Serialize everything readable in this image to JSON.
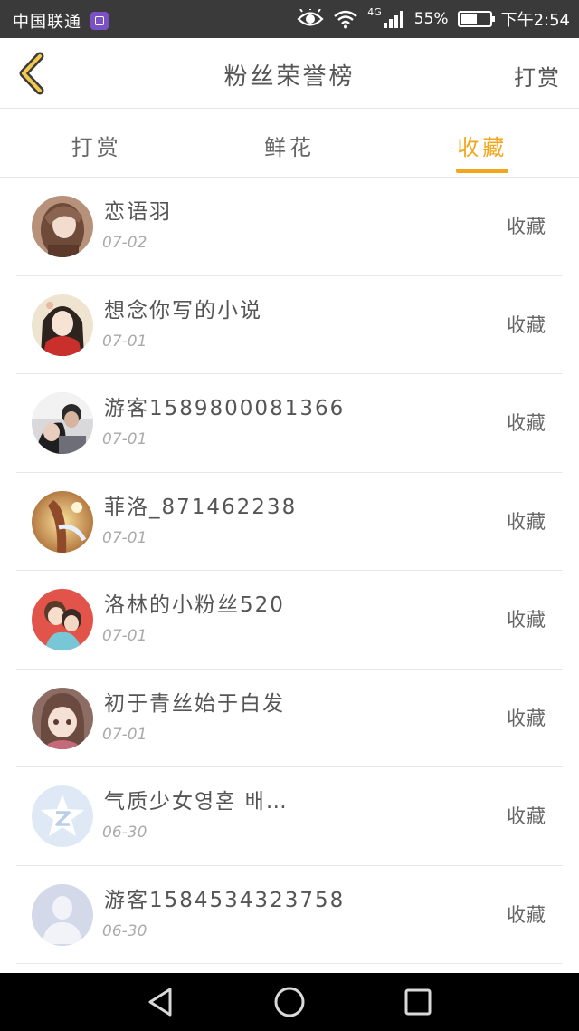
{
  "status_bar": {
    "carrier": "中国联通",
    "network": "4G",
    "battery_percent": "55%",
    "battery_level": 0.55,
    "time": "下午2:54",
    "icons": [
      "app-badge-icon",
      "eye-icon",
      "wifi-icon",
      "signal-icon",
      "battery-icon"
    ]
  },
  "header": {
    "title": "粉丝荣誉榜",
    "right_action": "打赏",
    "back_icon": "chevron-left-icon"
  },
  "tabs": [
    {
      "label": "打赏",
      "active": false
    },
    {
      "label": "鲜花",
      "active": false
    },
    {
      "label": "收藏",
      "active": true
    }
  ],
  "colors": {
    "accent": "#f2a61b",
    "status_bar": "#3a3a3a",
    "divider": "#e8e8e8"
  },
  "fans": [
    {
      "name": "恋语羽",
      "date": "07-02",
      "tag": "收藏",
      "avatar": "anime-girl-avatar"
    },
    {
      "name": "想念你写的小说",
      "date": "07-01",
      "tag": "收藏",
      "avatar": "anime-girl-red-avatar"
    },
    {
      "name": "游客1589800081366",
      "date": "07-01",
      "tag": "收藏",
      "avatar": "photo-avatar"
    },
    {
      "name": "菲洛_871462238",
      "date": "07-01",
      "tag": "收藏",
      "avatar": "golden-art-avatar"
    },
    {
      "name": "洛林的小粉丝520",
      "date": "07-01",
      "tag": "收藏",
      "avatar": "anime-couple-avatar"
    },
    {
      "name": "初于青丝始于白发",
      "date": "07-01",
      "tag": "收藏",
      "avatar": "anime-child-avatar"
    },
    {
      "name": "气质少女영혼 배…",
      "date": "06-30",
      "tag": "收藏",
      "avatar": "qq-default-avatar"
    },
    {
      "name": "游客1584534323758",
      "date": "06-30",
      "tag": "收藏",
      "avatar": "default-person-avatar"
    }
  ],
  "system_nav": [
    "back-triangle-icon",
    "home-circle-icon",
    "recents-square-icon"
  ]
}
